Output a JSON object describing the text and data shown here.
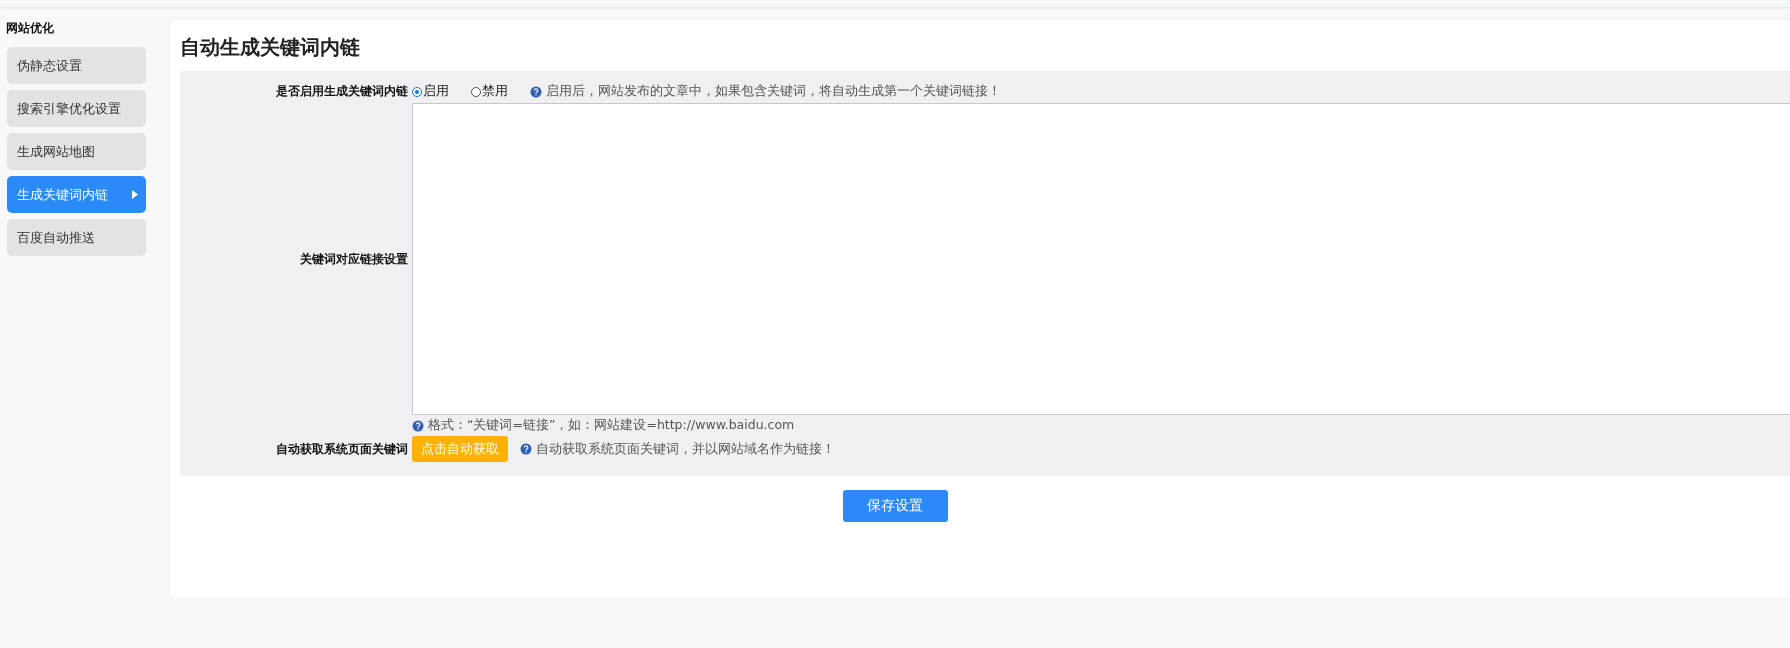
{
  "sidebar": {
    "title": "网站优化",
    "items": [
      {
        "label": "伪静态设置",
        "selected": false
      },
      {
        "label": "搜索引擎优化设置",
        "selected": false
      },
      {
        "label": "生成网站地图",
        "selected": false
      },
      {
        "label": "生成关键词内链",
        "selected": true
      },
      {
        "label": "百度自动推送",
        "selected": false
      }
    ]
  },
  "main": {
    "title": "自动生成关键词内链",
    "enable_row": {
      "label": "是否启用生成关键词内链",
      "options": [
        {
          "label": "启用",
          "selected": true
        },
        {
          "label": "禁用",
          "selected": false
        }
      ],
      "hint": "启用后，网站发布的文章中，如果包含关键词，将自动生成第一个关键词链接！"
    },
    "links_row": {
      "label": "关键词对应链接设置",
      "hint": "格式：“关键词=链接”，如：网站建设=http://www.baidu.com"
    },
    "auto_row": {
      "label": "自动获取系统页面关键词",
      "button": "点击自动获取",
      "hint": "自动获取系统页面关键词，并以网站域名作为链接！"
    },
    "save_button": "保存设置"
  }
}
